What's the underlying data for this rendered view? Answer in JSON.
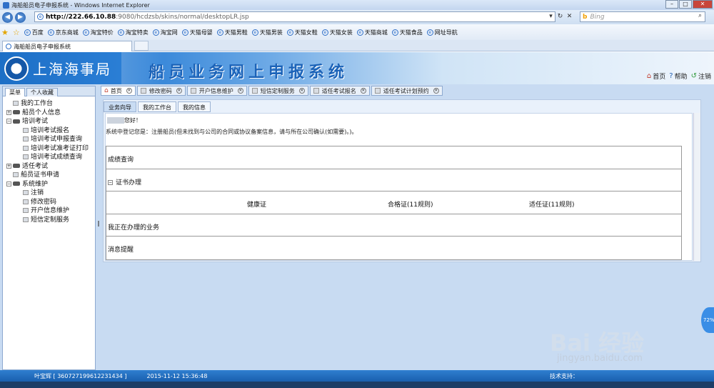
{
  "window": {
    "title": "海船船员电子申报系统 - Windows Internet Explorer",
    "controls": [
      "–",
      "□",
      "✕"
    ]
  },
  "browser": {
    "url_host": "http://222.66.10.88",
    "url_path": ":9080/hcdzsb/skins/normal/desktopLR.jsp",
    "search_placeholder": "Bing",
    "search_logo": "b",
    "favorites": [
      "百度",
      "京东商城",
      "淘宝特价",
      "淘宝特卖",
      "淘宝网",
      "天猫母婴",
      "天猫男鞋",
      "天猫男装",
      "天猫女鞋",
      "天猫女装",
      "天猫商城",
      "天猫食品",
      "网址导航"
    ],
    "tab_title": "海船船员电子申报系统"
  },
  "banner": {
    "org": "上海海事局",
    "system": "船员业务网上申报系统"
  },
  "top_links": {
    "home": "首页",
    "help": "帮助",
    "logout": "注销"
  },
  "sidebar": {
    "tabs": [
      "菜单",
      "个人收藏"
    ],
    "tree": [
      {
        "label": "我的工作台"
      },
      {
        "label": "船员个人信息"
      },
      {
        "label": "培训考试"
      },
      {
        "label": "培训考试报名"
      },
      {
        "label": "培训考试申报查询"
      },
      {
        "label": "培训考试准考证打印"
      },
      {
        "label": "培训考试成绩查询"
      },
      {
        "label": "适任考试"
      },
      {
        "label": "船员证书申请"
      },
      {
        "label": "系统维护"
      },
      {
        "label": "注销"
      },
      {
        "label": "修改密码"
      },
      {
        "label": "开户信息维护"
      },
      {
        "label": "短信定制服务"
      }
    ]
  },
  "page_tabs": [
    "首页",
    "修改密码",
    "开户信息维护",
    "短信定制服务",
    "适任考试报名",
    "适任考试计划预约"
  ],
  "sub_tabs": [
    "业务向导",
    "我的工作台",
    "我的信息"
  ],
  "main": {
    "greeting": "您好！",
    "notice": "系统中登记您是：注册船员(但未找到与公司的合同或协议备案信息，请与所在公司确认(如需要)。)。",
    "rows": {
      "score_query": "成绩查询",
      "cert_handle": "证书办理",
      "cert_items": [
        "健康证",
        "合格证(11规则)",
        "适任证(11规则)"
      ],
      "processing": "我正在办理的业务",
      "messages": "消息提醒"
    }
  },
  "status_bar": {
    "user": "叶宝辉 [ 360727199612231434 ]",
    "time": "2015-11-12 15:36:48",
    "support": "技术支持："
  },
  "overlay": {
    "zoom": "72%",
    "watermark": "Bai 经验",
    "watermark_url": "jingyan.baidu.com"
  }
}
